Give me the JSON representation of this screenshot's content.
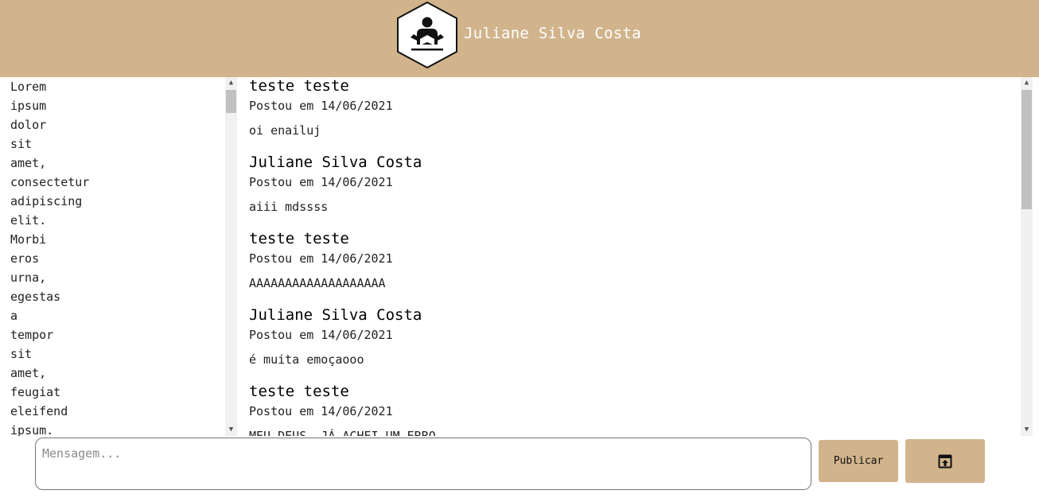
{
  "header": {
    "title": "Juliane Silva Costa",
    "logo_icon": "reader-person-icon",
    "background": "#d1b48c"
  },
  "sidebar": {
    "words": [
      "Lorem",
      "ipsum",
      "dolor",
      "sit",
      "amet,",
      "consectetur",
      "adipiscing",
      "elit.",
      "Morbi",
      "eros",
      "urna,",
      "egestas",
      "a",
      "tempor",
      "sit",
      "amet,",
      "feugiat",
      "eleifend",
      "ipsum."
    ]
  },
  "feed": {
    "posts": [
      {
        "author": "teste teste",
        "date": "Postou em 14/06/2021",
        "body": "oi enailuj"
      },
      {
        "author": "Juliane Silva Costa",
        "date": "Postou em 14/06/2021",
        "body": "aiii mdssss"
      },
      {
        "author": "teste teste",
        "date": "Postou em 14/06/2021",
        "body": "AAAAAAAAAAAAAAAAAAA"
      },
      {
        "author": "Juliane Silva Costa",
        "date": "Postou em 14/06/2021",
        "body": "é muita emoçaooo"
      },
      {
        "author": "teste teste",
        "date": "Postou em 14/06/2021",
        "body": "MEU DEUS, JÁ ACHEI UM ERRO"
      }
    ]
  },
  "composer": {
    "placeholder": "Mensagem...",
    "value": "",
    "publish_label": "Publicar",
    "upload_icon": "upload-file-icon"
  }
}
